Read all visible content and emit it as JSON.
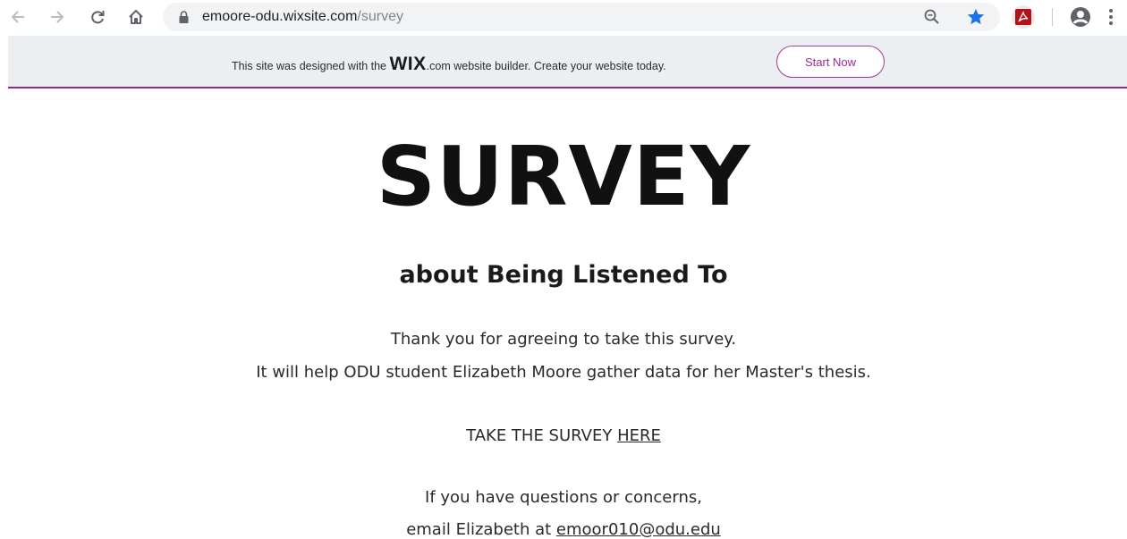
{
  "browser": {
    "url_host": "emoore-odu.wixsite.com",
    "url_path": "/survey",
    "icons": {
      "back": "back-arrow-icon",
      "forward": "forward-arrow-icon",
      "reload": "reload-icon",
      "home": "home-icon",
      "lock": "lock-icon",
      "zoom": "zoom-icon",
      "bookmark": "star-icon",
      "extension": "pdf-extension-icon",
      "profile": "profile-icon",
      "menu": "menu-icon"
    },
    "colors": {
      "star": "#1a73e8",
      "pdf": "#b3121b"
    }
  },
  "banner": {
    "text_before": "This site was designed with the ",
    "logo": "WIX",
    "logo_suffix": ".com",
    "text_after": " website builder. Create your website today.",
    "button_label": "Start Now",
    "accent_color": "#8e2b8a"
  },
  "page": {
    "title": "SURVEY",
    "subtitle": "about Being Listened To",
    "line1": "Thank you for agreeing to take this survey.",
    "line2": "It will help ODU student Elizabeth Moore gather data for her Master's thesis.",
    "cta_prefix": "TAKE THE SURVEY ",
    "cta_link": "HERE",
    "contact_line1": "If you have questions or concerns,",
    "contact_prefix": "email Elizabeth at ",
    "contact_email": "emoor010@odu.edu"
  }
}
